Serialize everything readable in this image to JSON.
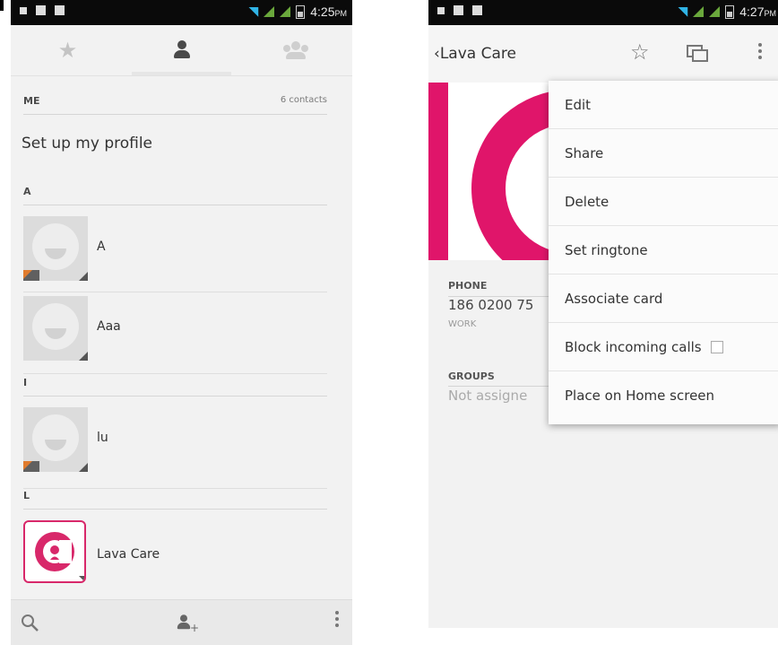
{
  "left_screen": {
    "status_bar": {
      "time": "4:25",
      "ampm": "PM"
    },
    "tabs": [
      {
        "name": "favorites",
        "icon": "star-icon"
      },
      {
        "name": "contacts",
        "icon": "person-icon",
        "active": true
      },
      {
        "name": "groups",
        "icon": "group-icon"
      }
    ],
    "me_section": {
      "header": "ME",
      "count": "6 contacts",
      "setup_label": "Set up my profile"
    },
    "sections": [
      {
        "letter": "A",
        "contacts": [
          {
            "name": "A",
            "sim": true
          },
          {
            "name": "Aaa",
            "sim": false
          }
        ]
      },
      {
        "letter": "I",
        "contacts": [
          {
            "name": "lu",
            "sim": true
          }
        ]
      },
      {
        "letter": "L",
        "contacts": [
          {
            "name": "Lava Care",
            "sim": false
          }
        ]
      }
    ],
    "bottom_bar": [
      "search-icon",
      "add-contact-icon",
      "overflow-menu-icon"
    ]
  },
  "right_screen": {
    "status_bar": {
      "time": "4:27",
      "ampm": "PM"
    },
    "action_bar": {
      "back_title": "Lava Care"
    },
    "details": {
      "phone_header": "PHONE",
      "phone_number": "186 0200 75",
      "phone_type": "WORK",
      "groups_header": "GROUPS",
      "groups_value": "Not assigne"
    },
    "menu": {
      "items": [
        "Edit",
        "Share",
        "Delete",
        "Set ringtone",
        "Associate card",
        "Block incoming calls",
        "Place on Home screen"
      ]
    },
    "colors": {
      "brand": "#e0156a",
      "accent": "#1ea3d6"
    }
  }
}
